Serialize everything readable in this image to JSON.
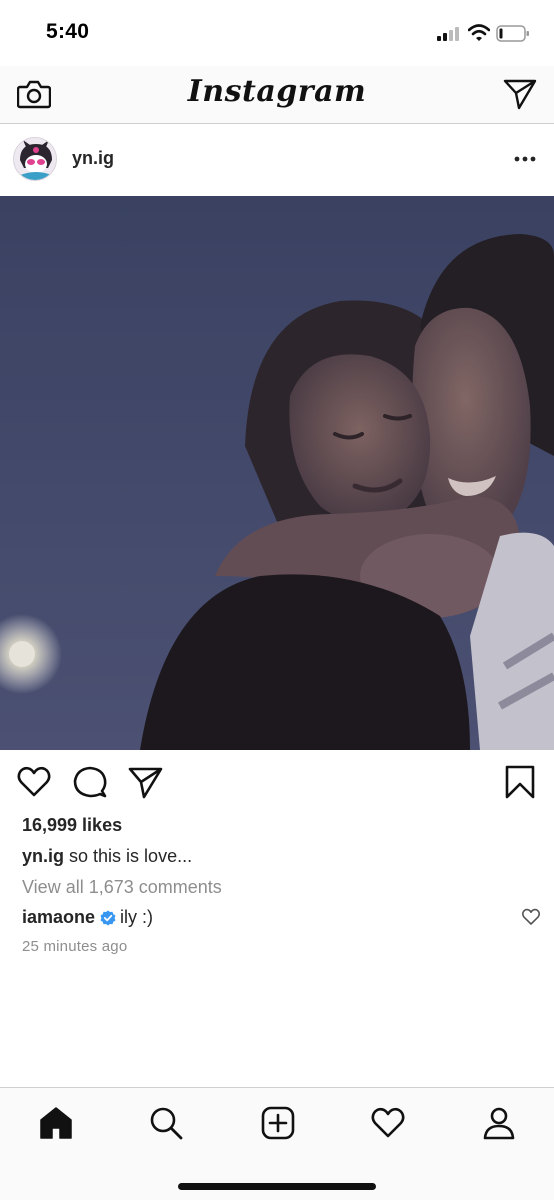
{
  "status_bar": {
    "time": "5:40"
  },
  "header": {
    "logo": "Instagram",
    "left_icon": "camera-icon",
    "right_icon": "direct-message-icon"
  },
  "post": {
    "username": "yn.ig",
    "avatar_icon": "avatar-character",
    "more_icon": "more-options-icon",
    "actions": {
      "like_icon": "heart-icon",
      "comment_icon": "comment-icon",
      "share_icon": "share-icon",
      "save_icon": "bookmark-icon"
    },
    "likes": "16,999 likes",
    "caption_user": "yn.ig",
    "caption_text": "so this is love...",
    "view_comments": "View all 1,673 comments",
    "top_comment": {
      "user": "iamaone",
      "verified": true,
      "text": "ily :)"
    },
    "timestamp": "25 minutes ago"
  },
  "bottom_nav": {
    "items": [
      "home-icon",
      "search-icon",
      "new-post-icon",
      "activity-heart-icon",
      "profile-icon"
    ],
    "active": "home-icon"
  },
  "colors": {
    "text": "#262626",
    "muted": "#8e8e8e",
    "verified": "#3897f0",
    "divider": "#cfcfcf"
  }
}
